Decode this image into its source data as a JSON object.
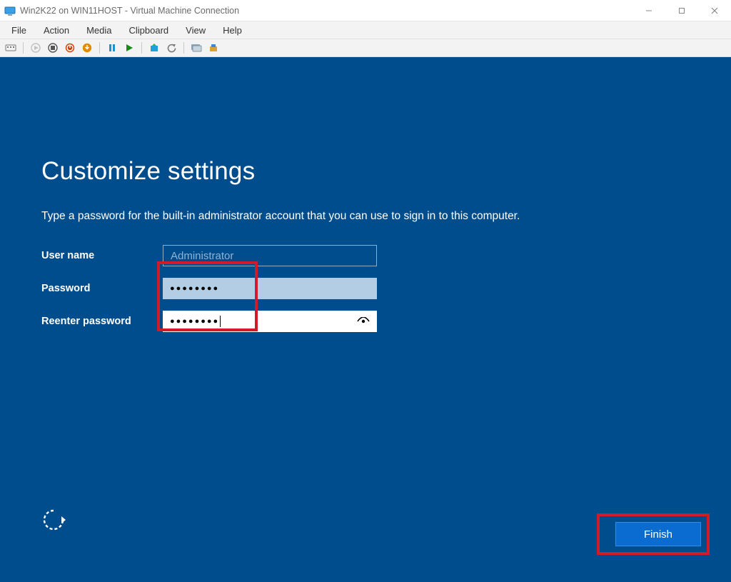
{
  "window": {
    "title": "Win2K22 on WIN11HOST - Virtual Machine Connection"
  },
  "menubar": {
    "items": [
      "File",
      "Action",
      "Media",
      "Clipboard",
      "View",
      "Help"
    ]
  },
  "toolbar": {
    "icons": [
      "ctrl-alt-del-icon",
      "start-icon-disabled",
      "turn-off-icon",
      "shutdown-icon",
      "save-icon",
      "pause-icon",
      "reset-icon",
      "checkpoint-icon",
      "revert-icon",
      "enhanced-session-icon",
      "share-icon"
    ]
  },
  "oobe": {
    "heading": "Customize settings",
    "instruction": "Type a password for the built-in administrator account that you can use to sign in to this computer.",
    "labels": {
      "username": "User name",
      "password": "Password",
      "reenter": "Reenter password"
    },
    "fields": {
      "username_value": "Administrator",
      "password_mask": "●●●●●●●●",
      "reenter_mask": "●●●●●●●●"
    },
    "finish_label": "Finish"
  }
}
